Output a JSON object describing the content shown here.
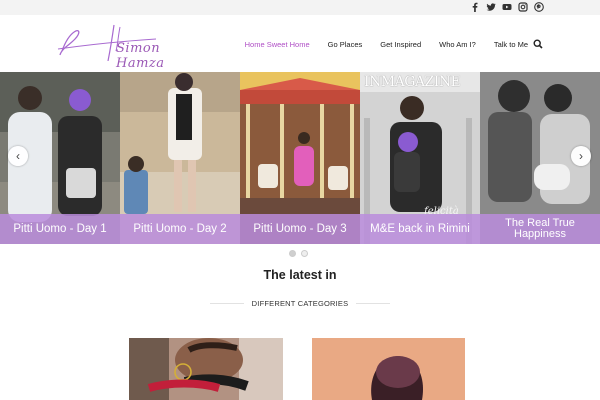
{
  "topbar": {
    "social_icons": [
      "facebook-icon",
      "twitter-icon",
      "youtube-icon",
      "instagram-icon",
      "pinterest-icon"
    ]
  },
  "header": {
    "logo_text": "Simon Hamza",
    "nav": [
      {
        "label": "Home Sweet Home",
        "active": true
      },
      {
        "label": "Go Places",
        "active": false
      },
      {
        "label": "Get Inspired",
        "active": false
      },
      {
        "label": "Who Am I?",
        "active": false
      },
      {
        "label": "Talk to Me",
        "active": false
      }
    ],
    "search_icon": "search-icon"
  },
  "slider": {
    "slides": [
      {
        "caption": "Pitti Uomo - Day 1"
      },
      {
        "caption": "Pitti Uomo - Day 2"
      },
      {
        "caption": "Pitti Uomo - Day 3"
      },
      {
        "caption": "M&E back in Rimini",
        "magazine_title": "INMAGAZINE",
        "magazine_sub": "felicità"
      },
      {
        "caption": "The Real True Happiness"
      }
    ],
    "prev_icon": "chevron-left-icon",
    "next_icon": "chevron-right-icon",
    "dots": 2
  },
  "latest": {
    "title": "The latest in",
    "subtitle": "DIFFERENT CATEGORIES"
  },
  "colors": {
    "accent": "#b04fc6",
    "caption_bg": "#ba8cdc",
    "topbar_bg": "#f3f3f3"
  }
}
